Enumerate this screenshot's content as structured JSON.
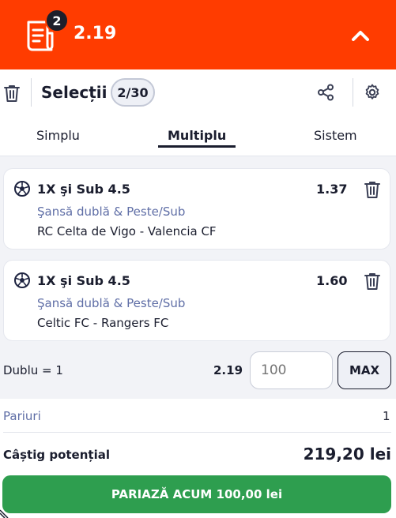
{
  "header": {
    "selections_badge": "2",
    "total_odds": "2.19"
  },
  "toolbar": {
    "title": "Selecții",
    "selection_count": "2/30"
  },
  "tabs": [
    {
      "label": "Simplu",
      "active": false
    },
    {
      "label": "Multiplu",
      "active": true
    },
    {
      "label": "Sistem",
      "active": false
    }
  ],
  "selections": [
    {
      "market": "1X şi Sub 4.5",
      "odd": "1.37",
      "market_type": "Şansă dublă & Peste/Sub",
      "event": "RC Celta de Vigo - Valencia CF"
    },
    {
      "market": "1X şi Sub 4.5",
      "odd": "1.60",
      "market_type": "Şansă dublă & Peste/Sub",
      "event": "Celtic FC - Rangers FC"
    }
  ],
  "combination": {
    "label": "Dublu = 1",
    "odds": "2.19",
    "stake_placeholder": "100",
    "max_label": "MAX"
  },
  "summary": {
    "bets_label": "Pariuri",
    "bets_value": "1",
    "win_label": "Câștig potențial",
    "win_value": "219,20 lei"
  },
  "place_bet": {
    "label": "PARIAZĂ ACUM 100,00 lei"
  },
  "colors": {
    "brand": "#ff3c00",
    "action": "#2e9e4f",
    "text": "#1a1d2e",
    "muted": "#5f6ea6"
  }
}
